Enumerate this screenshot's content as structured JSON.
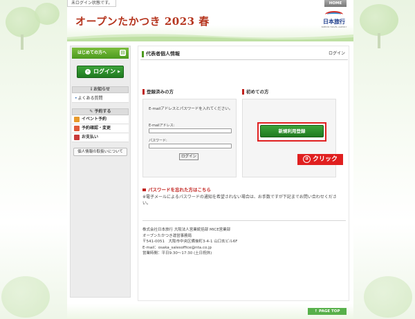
{
  "header": {
    "login_status": "未ログイン状態です。",
    "home_label": "HOME",
    "site_title": "オープンたかつき 2023 春",
    "logo_text": "日本旅行",
    "logo_sub": "NIPPON TRAVEL AGENCY"
  },
  "sidebar": {
    "first_visit": "はじめての方へ",
    "login_button": "ログイン",
    "news_heading": "お知らせ",
    "faq_link": "よくある質問",
    "reserve_heading": "予約する",
    "menu": [
      {
        "label": "イベント予約",
        "icon_color": "#e89a2c"
      },
      {
        "label": "予約確認・変更",
        "icon_color": "#e05a3a"
      },
      {
        "label": "お支払い",
        "icon_color": "#c93b3b"
      }
    ],
    "privacy_button": "個人情報の取扱いについて"
  },
  "main": {
    "title": "代表者個人情報",
    "login_link": "ログイン",
    "registered": {
      "heading": "登録済みの方",
      "instruction": "E-mailアドレスとパスワードを入れてください。",
      "email_label": "E-mailアドレス:",
      "password_label": "パスワード:",
      "submit": "ログイン"
    },
    "first_time": {
      "heading": "初めての方",
      "register_button": "新規利用登録"
    },
    "annotation": {
      "number": "②",
      "text": "クリック"
    },
    "forgot_password": "パスワードを忘れた方はこちら",
    "note": "※電子メールによるパスワードの通知を希望されない場合は、お手数ですが下記までお問い合わせください。",
    "company": [
      "株式会社日本旅行 大阪法人営業統括部 MICE営業部",
      "オープンたかつき運営事務局",
      "〒541-0051　大阪市中央区備後町3-4-1 山口玄ビル6F",
      "E-mail：osaka_salesoffice@nta.co.jp",
      "営業時間：平日9:30〜17:30 (土日祝休)"
    ]
  },
  "footer": {
    "page_top": "PAGE TOP"
  },
  "colors": {
    "brand_red": "#b5351e",
    "brand_green": "#3da33a",
    "annotation_red": "#e02020"
  }
}
